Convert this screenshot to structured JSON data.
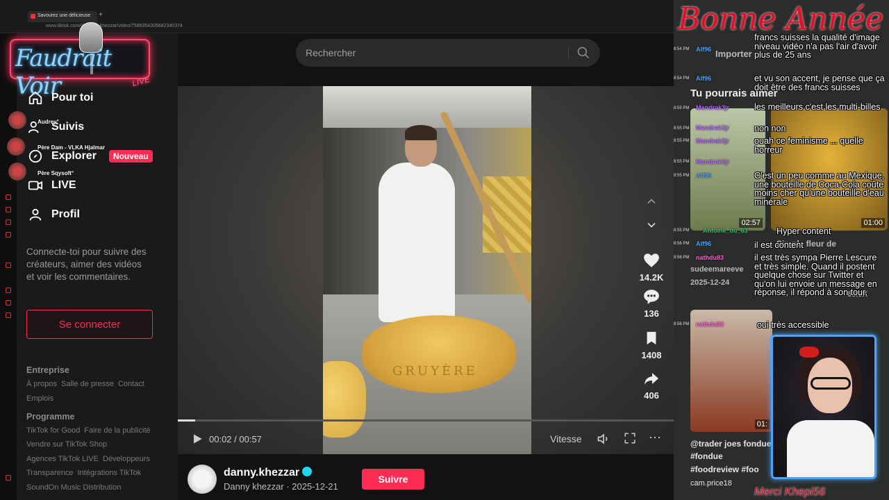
{
  "browser": {
    "tab_title": "Savourez une délicieuse",
    "url": "www.tiktok.com/@danny.khezzar/video/7586354305682340374"
  },
  "overlay": {
    "logo_text": "Faudrait Voir",
    "logo_live": "LIVE",
    "viewers": [
      "Audrey°",
      "Père Dam - VLKA Hjalmar",
      "Père Sqysoft°"
    ],
    "banner": "Bonne Année",
    "merci": "Merci Khepi56"
  },
  "sidebar": {
    "nav": [
      {
        "label": "Pour toi",
        "icon": "home-icon"
      },
      {
        "label": "Suivis",
        "icon": "following-icon"
      },
      {
        "label": "Explorer",
        "icon": "compass-icon",
        "badge": "Nouveau"
      },
      {
        "label": "LIVE",
        "icon": "live-icon"
      },
      {
        "label": "Profil",
        "icon": "profile-icon"
      }
    ],
    "login_prompt": "Connecte-toi pour suivre des créateurs, aimer des vidéos et voir les commentaires.",
    "login_button": "Se connecter",
    "footer": {
      "entreprise_title": "Entreprise",
      "entreprise_row1": [
        "À propos",
        "Salle de presse",
        "Contact"
      ],
      "entreprise_row2": [
        "Emplois"
      ],
      "programme_title": "Programme",
      "programme_row1": [
        "TikTok for Good",
        "Faire de la publicité"
      ],
      "programme_row2": [
        "Vendre sur TikTok Shop"
      ],
      "programme_row3": [
        "Agences TikTok LIVE",
        "Développeurs"
      ],
      "programme_row4": [
        "Transparence",
        "Intégrations TikTok"
      ],
      "programme_row5": [
        "SoundOn Music Distribution"
      ]
    }
  },
  "search": {
    "placeholder": "Rechercher"
  },
  "video": {
    "current_time": "00:02",
    "duration": "00:57",
    "time_display": "00:02 / 00:57",
    "progress": 0.035,
    "speed_label": "Vitesse",
    "wheel_text": "GRUYÈRE"
  },
  "actions": {
    "likes": "14.2K",
    "comments": "136",
    "saves": "1408",
    "shares": "406"
  },
  "author": {
    "username": "danny.khezzar",
    "display_name": "Danny khezzar",
    "date": "2025-12-21",
    "subtitle": "Danny khezzar · 2025-12-21",
    "follow_label": "Suivre"
  },
  "right_panel": {
    "import_label": "Importer",
    "suggest_title": "Tu pourrais aimer",
    "thumb1_time": "01:00",
    "thumb0_time": "02:57",
    "card_user": "sudeemareeve",
    "card_date": "2025-12-24",
    "card_likes": "69.8K",
    "card_caption": "Simple fleur de",
    "card2_caption": "@trader joes fondue",
    "card2_tags": "#fondue",
    "card2_tags2": "#foodreview #foo",
    "card2_user": "cam.price18",
    "card2_time": "01:"
  },
  "chat": [
    {
      "user": "Alf96",
      "time": "8:54 PM",
      "text": "francs suisses la qualité d'image niveau vidéo n'a pas l'air d'avoir plus de 25 ans"
    },
    {
      "user": "Alf96",
      "time": "8:54 PM",
      "text": "et vu son accent, je pense que ça doit être des francs suisses"
    },
    {
      "user": "Mandrak3jr",
      "time": "8:55 PM",
      "text": "les meilleurs c'est les multi-billes"
    },
    {
      "user": "Mandrak3jr",
      "time": "8:55 PM",
      "text": "non non"
    },
    {
      "user": "Mandrak3jr",
      "time": "8:55 PM",
      "text": "ouah ce feminisme ... quelle horreur"
    },
    {
      "user": "Mandrak3jr",
      "time": "8:55 PM",
      "text": ""
    },
    {
      "user": "Alf96",
      "time": "8:55 PM",
      "text": "C'est un peu comme au Mexique, une bouteille de Coca-Cola coûte moins cher qu'une bouteille d'eau minérale"
    },
    {
      "user": "Antoine_du_63",
      "time": "8:55 PM",
      "text": "Hyper content"
    },
    {
      "user": "Alf96",
      "time": "8:56 PM",
      "text": "il est content"
    },
    {
      "user": "nathdu83",
      "time": "8:56 PM",
      "text": "il est très sympa Pierre Lescure et très simple. Quand il postent quelque chose sur Twitter et qu'on lui envoie un message en réponse, il répond à son tour."
    },
    {
      "user": "nathdu83",
      "time": "8:56 PM",
      "text": "oui très accessible"
    }
  ],
  "colors": {
    "accent": "#fe2c55",
    "verified": "#20d5ec",
    "webcam_border": "#4aa3ff"
  }
}
